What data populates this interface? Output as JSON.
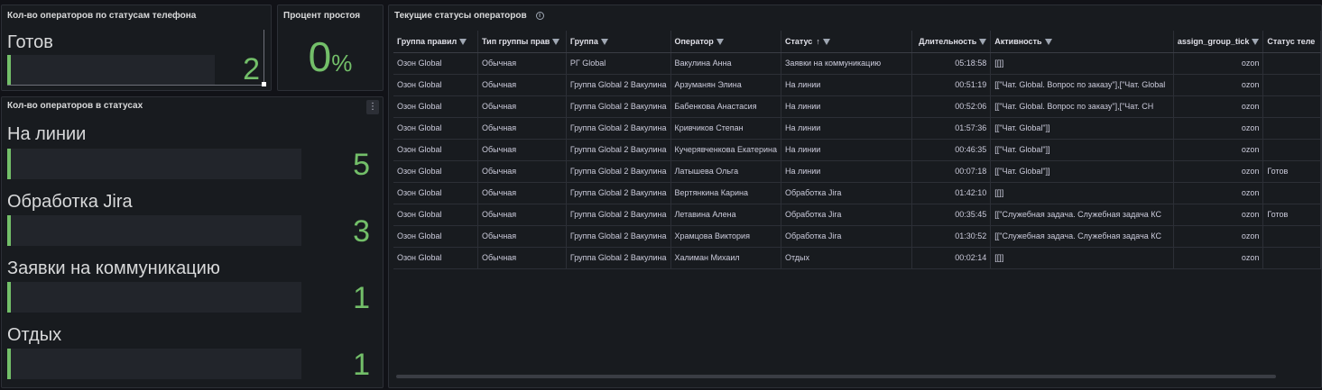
{
  "panels": {
    "phone_status": {
      "title": "Кол-во операторов по статусам телефона",
      "items": [
        {
          "label": "Готов",
          "value": "2"
        }
      ]
    },
    "idle": {
      "title": "Процент простоя",
      "value": "0",
      "unit": "%"
    },
    "status_counts": {
      "title": "Кол-во операторов в статусах",
      "menu": "⋮",
      "items": [
        {
          "label": "На линии",
          "value": "5"
        },
        {
          "label": "Обработка Jira",
          "value": "3"
        },
        {
          "label": "Заявки на коммуникацию",
          "value": "1"
        },
        {
          "label": "Отдых",
          "value": "1"
        }
      ]
    },
    "table": {
      "title": "Текущие статусы операторов",
      "info": "i",
      "columns": [
        "Группа правил",
        "Тип группы прав",
        "Группа",
        "Оператор",
        "Статус",
        "Длительность",
        "Активность",
        "assign_group_tick",
        "Статус теле"
      ],
      "sort_arrow": "↑",
      "rows": [
        [
          "Озон Global",
          "Обычная",
          "РГ Global",
          "Вакулина Анна",
          "Заявки на коммуникацию",
          "05:18:58",
          "[[]]",
          "ozon",
          ""
        ],
        [
          "Озон Global",
          "Обычная",
          "Группа Global 2 Вакулина",
          "Арзуманян Элина",
          "На линии",
          "00:51:19",
          "[[\"Чат. Global. Вопрос по заказу\"],[\"Чат. Global",
          "ozon",
          ""
        ],
        [
          "Озон Global",
          "Обычная",
          "Группа Global 2 Вакулина",
          "Бабенкова Анастасия",
          "На линии",
          "00:52:06",
          "[[\"Чат. Global. Вопрос по заказу\"],[\"Чат. СН",
          "ozon",
          ""
        ],
        [
          "Озон Global",
          "Обычная",
          "Группа Global 2 Вакулина",
          "Кривчиков Степан",
          "На линии",
          "01:57:36",
          "[[\"Чат. Global\"]]",
          "ozon",
          ""
        ],
        [
          "Озон Global",
          "Обычная",
          "Группа Global 2 Вакулина",
          "Кучерявченкова Екатерина",
          "На линии",
          "00:46:35",
          "[[\"Чат. Global\"]]",
          "ozon",
          ""
        ],
        [
          "Озон Global",
          "Обычная",
          "Группа Global 2 Вакулина",
          "Латышева Ольга",
          "На линии",
          "00:07:18",
          "[[\"Чат. Global\"]]",
          "ozon",
          "Готов"
        ],
        [
          "Озон Global",
          "Обычная",
          "Группа Global 2 Вакулина",
          "Вертянкина Карина",
          "Обработка Jira",
          "01:42:10",
          "[[]]",
          "ozon",
          ""
        ],
        [
          "Озон Global",
          "Обычная",
          "Группа Global 2 Вакулина",
          "Летавина Алена",
          "Обработка Jira",
          "00:35:45",
          "[[\"Служебная задача. Служебная задача КС",
          "ozon",
          "Готов"
        ],
        [
          "Озон Global",
          "Обычная",
          "Группа Global 2 Вакулина",
          "Храмцова Виктория",
          "Обработка Jira",
          "01:30:52",
          "[[\"Служебная задача. Служебная задача КС",
          "ozon",
          ""
        ],
        [
          "Озон Global",
          "Обычная",
          "Группа Global 2 Вакулина",
          "Халиман Михаил",
          "Отдых",
          "00:02:14",
          "[[]]",
          "ozon",
          ""
        ]
      ]
    }
  },
  "colors": {
    "accent": "#73bf69",
    "panel_bg": "#181b1f",
    "page_bg": "#111217"
  }
}
